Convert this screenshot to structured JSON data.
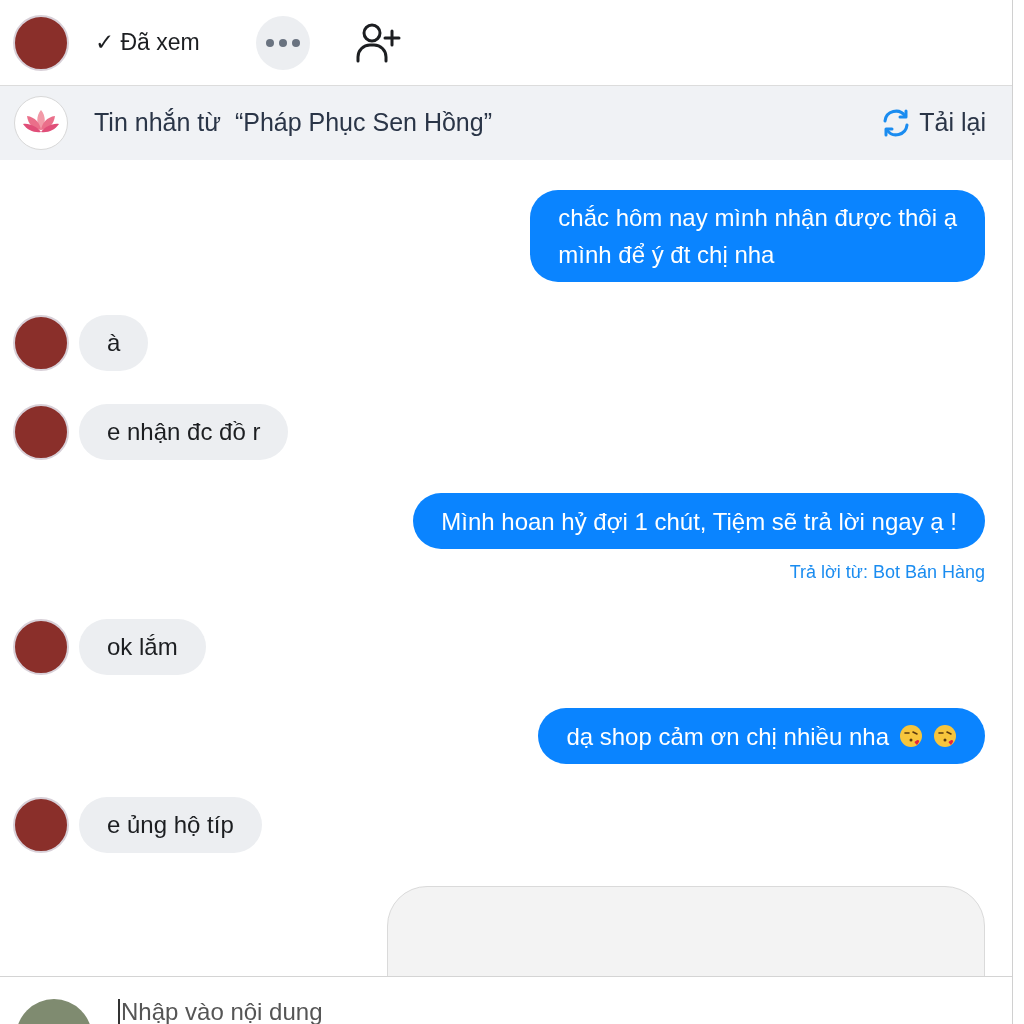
{
  "top_bar": {
    "seen_label": "✓ Đã xem"
  },
  "source_bar": {
    "title": "Tin nhắn từ  “Pháp Phục Sen Hồng”",
    "reload_label": "Tải lại"
  },
  "messages": [
    {
      "kind": "outgoing",
      "text": "chắc hôm nay mình nhận được thôi ạ\nmình để ý đt chị nha"
    },
    {
      "kind": "incoming",
      "text": "à"
    },
    {
      "kind": "incoming",
      "text": "e nhận đc đồ r"
    },
    {
      "kind": "outgoing",
      "text": "Mình hoan hỷ đợi 1 chút, Tiệm sẽ trả lời ngay ạ !",
      "caption": "Trả lời từ: Bot Bán Hàng"
    },
    {
      "kind": "incoming",
      "text": "ok lắm"
    },
    {
      "kind": "outgoing",
      "text": "dạ shop cảm ơn chị nhiều nha",
      "emoji": [
        {
          "kind": "kiss"
        },
        {
          "kind": "kiss"
        }
      ]
    },
    {
      "kind": "incoming",
      "text": "e ủng hộ típ"
    },
    {
      "kind": "card"
    }
  ],
  "composer": {
    "placeholder": "Nhập vào nội dung"
  }
}
